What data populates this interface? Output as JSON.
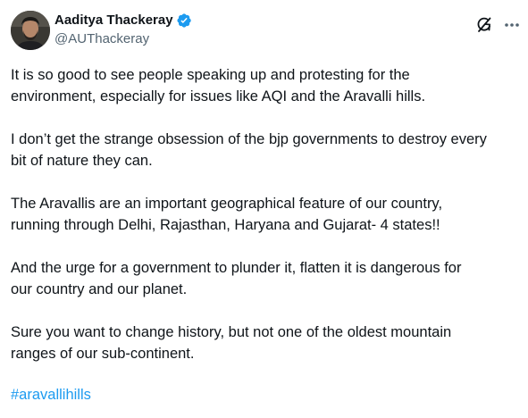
{
  "tweet": {
    "author": {
      "display_name": "Aaditya Thackeray",
      "handle": "@AUThackeray",
      "verified": true,
      "verified_color": "#1d9bf0"
    },
    "header_icons": [
      "grok-icon",
      "more-options-icon"
    ],
    "paragraphs": [
      "It is so good to see people speaking up and protesting for the\nenvironment, especially for issues like AQI and the Aravalli hills.",
      "I don’t get the strange obsession of the bjp governments to destroy every\nbit of nature they can.",
      "The Aravallis are an important geographical feature of our country,\nrunning through Delhi, Rajasthan, Haryana and Gujarat- 4 states!!",
      "And the urge for a government to plunder it, flatten it is dangerous for\nour country and our planet.",
      "Sure you want to change history, but not one of the oldest mountain\nranges of our sub-continent."
    ],
    "hashtag": "#aravallihills",
    "hashtag_color": "#1d9bf0"
  }
}
